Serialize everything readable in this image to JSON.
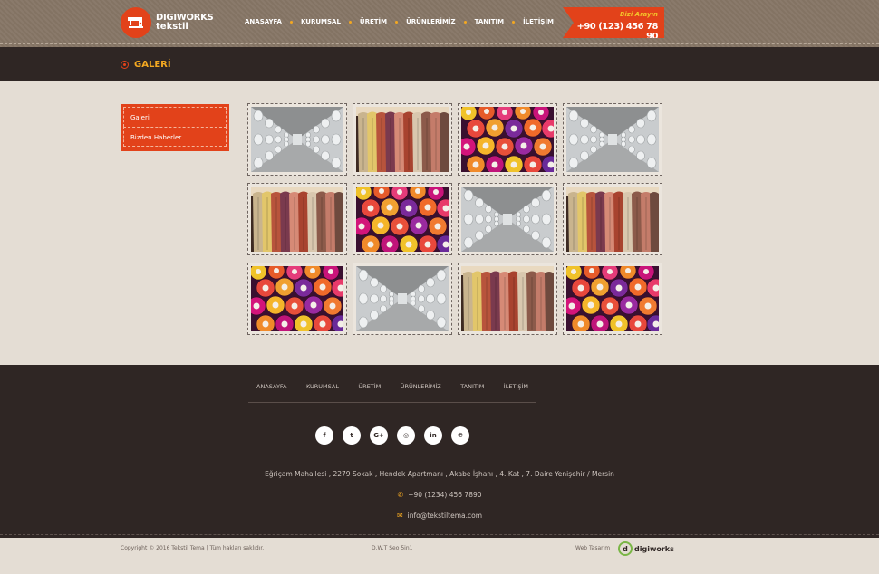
{
  "brand": {
    "line1": "DIGIWORKS",
    "line2": "tekstil"
  },
  "nav": [
    "ANASAYFA",
    "KURUMSAL",
    "ÜRETİM",
    "ÜRÜNLERİMİZ",
    "TANITIM",
    "İLETİŞİM"
  ],
  "call": {
    "title": "Bizi Arayın",
    "phone": "+90 (123) 456 78 90"
  },
  "page_title": "GALERİ",
  "sidebar": [
    "Galeri",
    "Bizden Haberler"
  ],
  "gallery": [
    "bobbins-white",
    "fabrics",
    "spools-color",
    "bobbins-white",
    "fabrics",
    "spools-color",
    "bobbins-white",
    "fabrics",
    "spools-color",
    "bobbins-white",
    "fabrics",
    "spools-color"
  ],
  "footer": {
    "nav": [
      "ANASAYFA",
      "KURUMSAL",
      "ÜRETİM",
      "ÜRÜNLERİMİZ",
      "TANITIM",
      "İLETİŞİM"
    ],
    "socials": [
      "facebook-icon",
      "twitter-icon",
      "google-plus-icon",
      "instagram-icon",
      "linkedin-icon",
      "pinterest-icon"
    ],
    "social_glyphs": [
      "f",
      "t",
      "G+",
      "◎",
      "in",
      "℗"
    ],
    "address": "Eğriçam Mahallesi , 2279 Sokak , Hendek Apartmanı , Akabe İşhanı , 4. Kat , 7. Daire Yenişehir / Mersin",
    "phone": "+90 (1234) 456 7890",
    "email": "info@tekstiltema.com"
  },
  "bottom": {
    "copyright": "Copyright © 2016 Tekstil Tema | Tüm hakları saklıdır.",
    "center": "D.W.T Seo 5in1",
    "credit_label": "Web Tasarım",
    "credit_logo": "digiworks"
  },
  "colors": {
    "accent": "#e2421a",
    "gold": "#f3a821",
    "dark": "#2f2624",
    "bg": "#e4ddd4"
  }
}
